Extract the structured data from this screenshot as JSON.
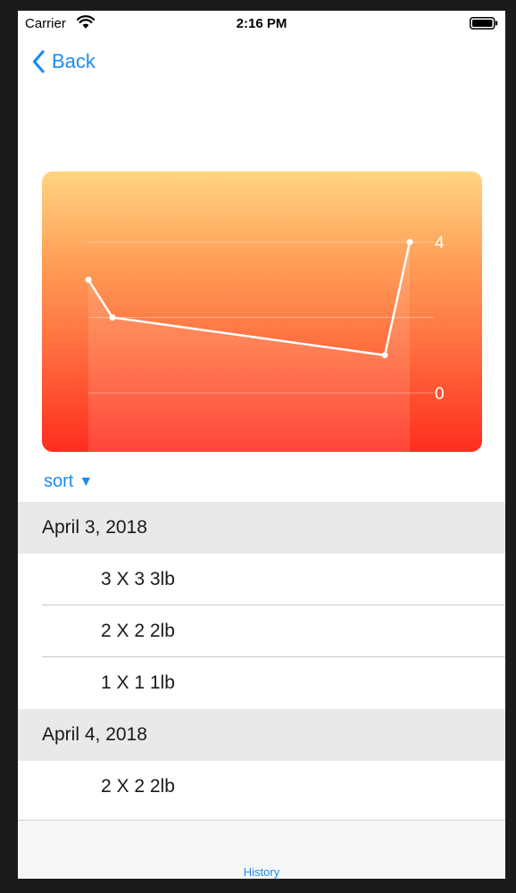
{
  "status_bar": {
    "carrier": "Carrier",
    "time": "2:16 PM"
  },
  "nav": {
    "back_label": "Back"
  },
  "chart_data": {
    "type": "line",
    "x_labels": [],
    "values": [
      3.0,
      2.0,
      1.0,
      4.0
    ],
    "y_ticks": [
      0,
      4
    ],
    "ylim": [
      -1,
      4.5
    ],
    "gridlines": [
      0,
      2,
      4
    ],
    "title": "",
    "xlabel": "",
    "ylabel": ""
  },
  "sort": {
    "label": "sort",
    "arrow": "▼"
  },
  "history": [
    {
      "date": "April 3, 2018",
      "entries": [
        "3 X 3 3lb",
        "2 X 2 2lb",
        "1 X 1 1lb"
      ]
    },
    {
      "date": "April 4, 2018",
      "entries": [
        "2 X 2 2lb"
      ]
    }
  ],
  "tab_bar": {
    "history_label": "History"
  },
  "colors": {
    "accent": "#1a8cf0",
    "chart_top": "#ffd580",
    "chart_bottom": "#ff2d1f"
  }
}
